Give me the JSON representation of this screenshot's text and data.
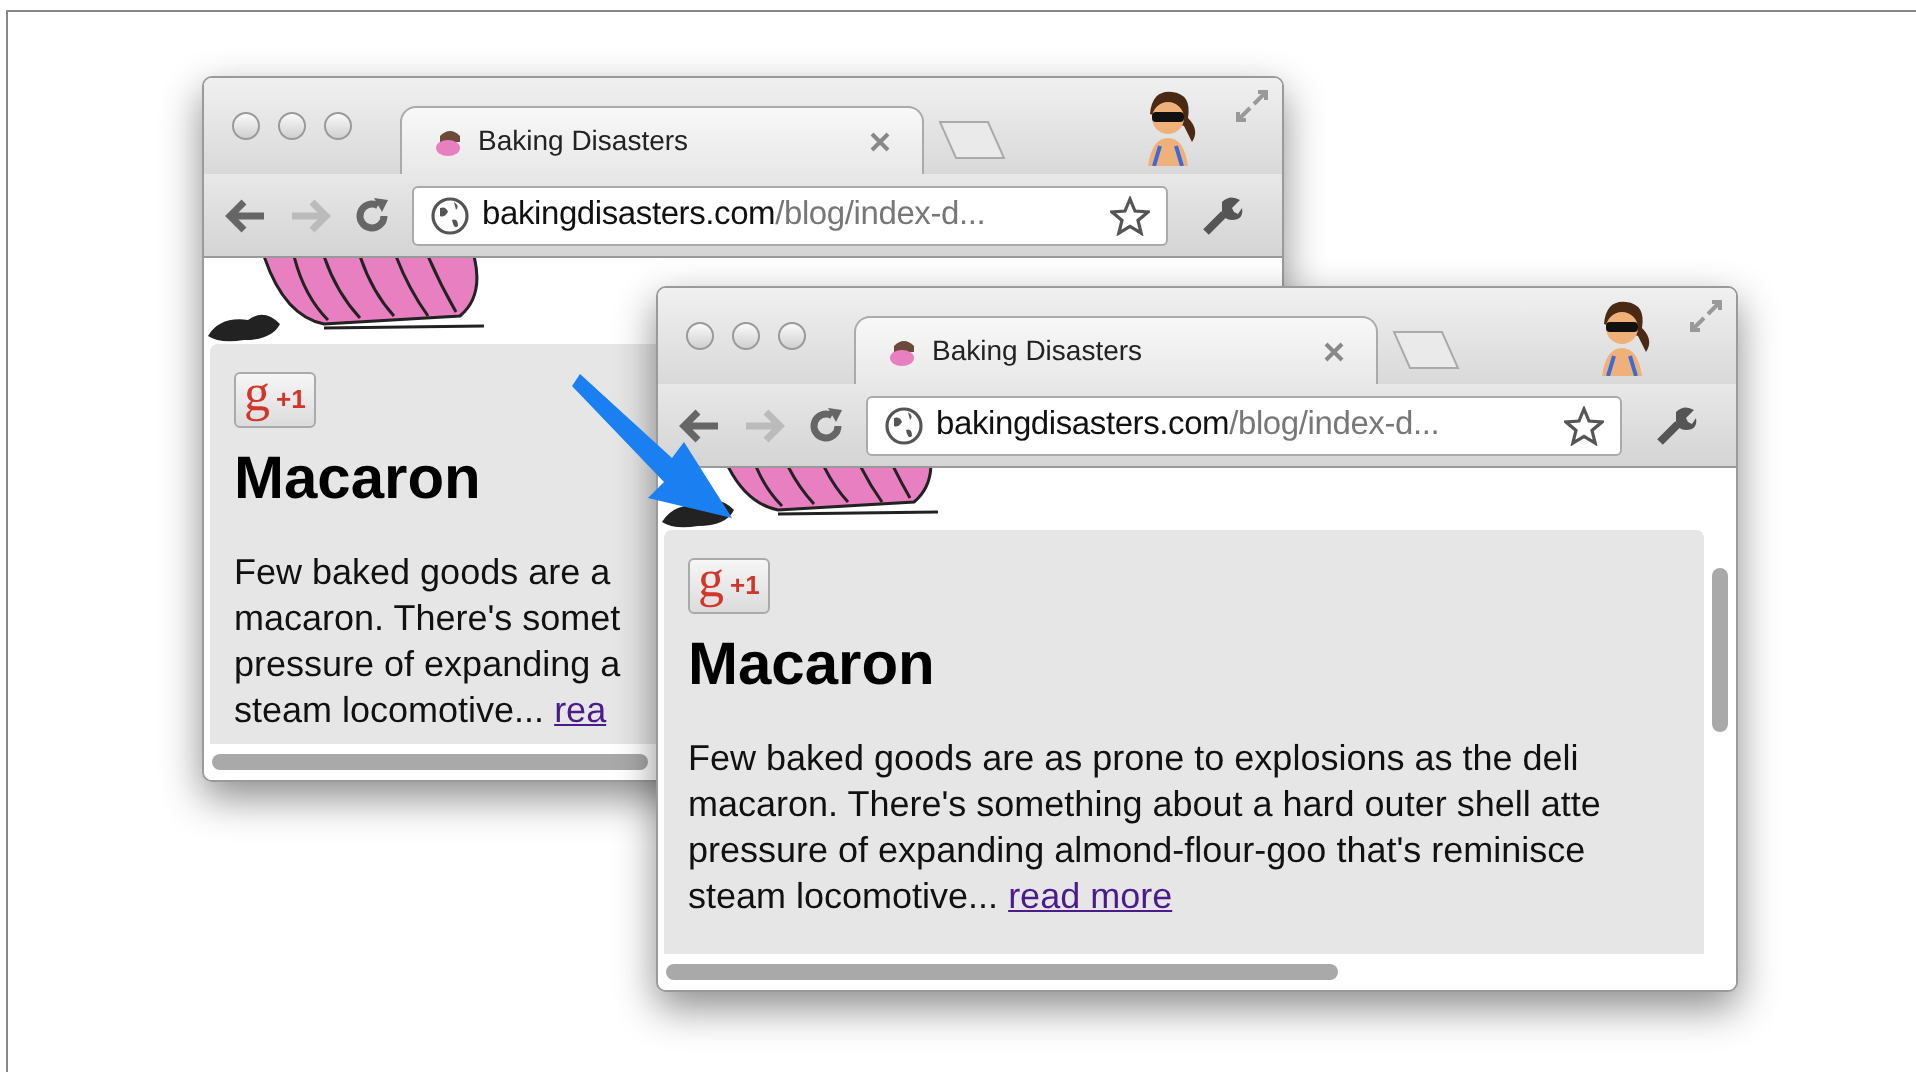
{
  "windows": [
    {
      "tab": {
        "title": "Baking Disasters"
      },
      "forward_disabled": true,
      "url": {
        "host": "bakingdisasters.com",
        "path": "/blog/index-d..."
      },
      "post": {
        "plus_one": {
          "logo": "g",
          "count": "+1"
        },
        "title": "Macaron",
        "lines": [
          "Few baked goods are a",
          "macaron. There's somet",
          "pressure of expanding a",
          "steam locomotive... "
        ],
        "link": "rea"
      }
    },
    {
      "tab": {
        "title": "Baking Disasters"
      },
      "forward_disabled": true,
      "url": {
        "host": "bakingdisasters.com",
        "path": "/blog/index-d..."
      },
      "post": {
        "plus_one": {
          "logo": "g",
          "count": "+1"
        },
        "title": "Macaron",
        "lines": [
          "Few baked goods are as prone to explosions as the deli",
          "macaron. There's something about a hard outer shell atte",
          "pressure of expanding almond-flour-goo that's reminisce",
          "steam locomotive... "
        ],
        "link": "read more"
      }
    }
  ]
}
